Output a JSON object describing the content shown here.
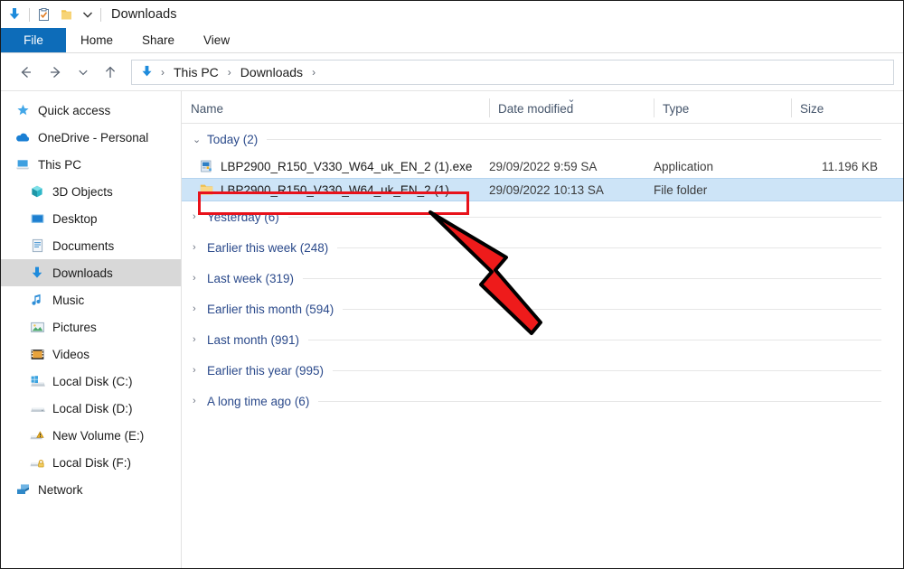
{
  "titlebar": {
    "title": "Downloads",
    "icons": [
      "downloads-arrow-icon",
      "properties-icon",
      "new-folder-icon",
      "customize-toolbar-chevron-icon"
    ]
  },
  "ribbon": {
    "tabs": [
      {
        "label": "File",
        "active": true
      },
      {
        "label": "Home",
        "active": false
      },
      {
        "label": "Share",
        "active": false
      },
      {
        "label": "View",
        "active": false
      }
    ]
  },
  "addressbar": {
    "back_icon": "back-arrow-icon",
    "forward_icon": "forward-arrow-icon",
    "recent_icon": "recent-locations-chevron-icon",
    "up_icon": "up-arrow-icon",
    "path_icon": "downloads-arrow-icon",
    "crumbs": [
      "This PC",
      "Downloads"
    ],
    "separator": "›"
  },
  "sidebar": {
    "items": [
      {
        "label": "Quick access",
        "icon": "star-icon",
        "indent": false,
        "selected": false
      },
      {
        "label": "OneDrive - Personal",
        "icon": "cloud-icon",
        "indent": false,
        "selected": false
      },
      {
        "label": "This PC",
        "icon": "computer-icon",
        "indent": false,
        "selected": false
      },
      {
        "label": "3D Objects",
        "icon": "cube-icon",
        "indent": true,
        "selected": false
      },
      {
        "label": "Desktop",
        "icon": "desktop-icon",
        "indent": true,
        "selected": false
      },
      {
        "label": "Documents",
        "icon": "documents-icon",
        "indent": true,
        "selected": false
      },
      {
        "label": "Downloads",
        "icon": "downloads-arrow-icon",
        "indent": true,
        "selected": true
      },
      {
        "label": "Music",
        "icon": "music-note-icon",
        "indent": true,
        "selected": false
      },
      {
        "label": "Pictures",
        "icon": "pictures-icon",
        "indent": true,
        "selected": false
      },
      {
        "label": "Videos",
        "icon": "videos-icon",
        "indent": true,
        "selected": false
      },
      {
        "label": "Local Disk (C:)",
        "icon": "windows-drive-icon",
        "indent": true,
        "selected": false
      },
      {
        "label": "Local Disk (D:)",
        "icon": "drive-icon",
        "indent": true,
        "selected": false
      },
      {
        "label": "New Volume (E:)",
        "icon": "drive-warning-icon",
        "indent": true,
        "selected": false
      },
      {
        "label": "Local Disk (F:)",
        "icon": "drive-lock-icon",
        "indent": true,
        "selected": false
      },
      {
        "label": "Network",
        "icon": "network-icon",
        "indent": false,
        "selected": false
      }
    ]
  },
  "filelist": {
    "columns": [
      {
        "label": "Name",
        "sorted": false
      },
      {
        "label": "Date modified",
        "sorted": true
      },
      {
        "label": "Type",
        "sorted": false
      },
      {
        "label": "Size",
        "sorted": false
      }
    ],
    "sort_chevron": "⌄",
    "groups": [
      {
        "label": "Today (2)",
        "expanded": true,
        "chevron": "⌄",
        "items": [
          {
            "name": "LBP2900_R150_V330_W64_uk_EN_2 (1).exe",
            "date": "29/09/2022 9:59 SA",
            "type": "Application",
            "size": "11.196 KB",
            "icon": "application-exe-icon",
            "selected": false
          },
          {
            "name": "LBP2900_R150_V330_W64_uk_EN_2 (1)",
            "date": "29/09/2022 10:13 SA",
            "type": "File folder",
            "size": "",
            "icon": "folder-icon",
            "selected": true
          }
        ]
      },
      {
        "label": "Yesterday (6)",
        "expanded": false,
        "chevron": "›",
        "items": []
      },
      {
        "label": "Earlier this week (248)",
        "expanded": false,
        "chevron": "›",
        "items": []
      },
      {
        "label": "Last week (319)",
        "expanded": false,
        "chevron": "›",
        "items": []
      },
      {
        "label": "Earlier this month (594)",
        "expanded": false,
        "chevron": "›",
        "items": []
      },
      {
        "label": "Last month (991)",
        "expanded": false,
        "chevron": "›",
        "items": []
      },
      {
        "label": "Earlier this year (995)",
        "expanded": false,
        "chevron": "›",
        "items": []
      },
      {
        "label": "A long time ago (6)",
        "expanded": false,
        "chevron": "›",
        "items": []
      }
    ]
  },
  "annotations": {
    "highlight_box": {
      "color": "#e8121b"
    },
    "arrow": {
      "color": "#ee1b1b",
      "outline": "#000000"
    }
  }
}
